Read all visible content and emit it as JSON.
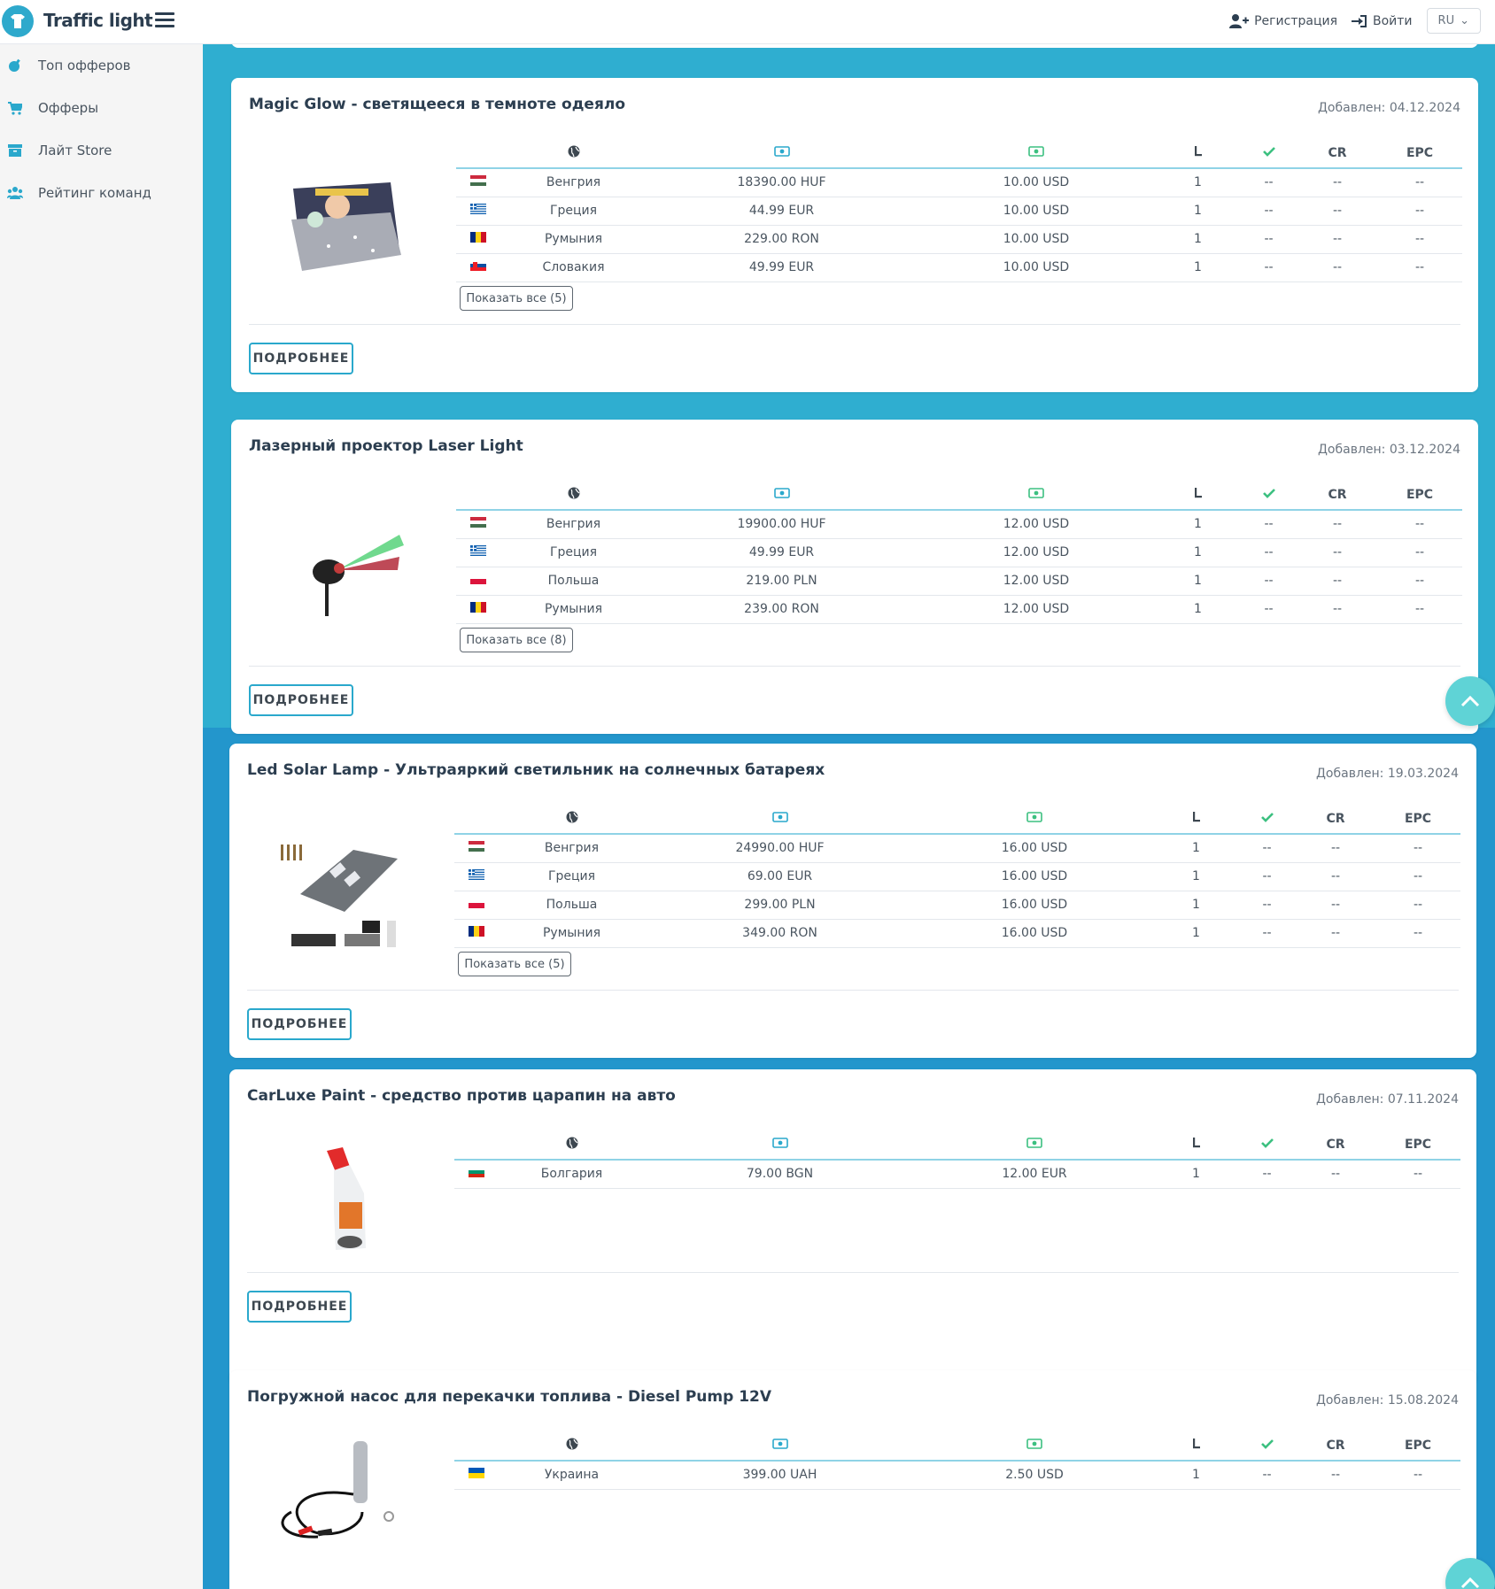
{
  "header": {
    "app_name": "Traffic light",
    "register_label": "Регистрация",
    "login_label": "Войти",
    "lang": "RU"
  },
  "sidebar": {
    "items": [
      {
        "label": "Топ офферов",
        "icon": "bomb-icon"
      },
      {
        "label": "Офферы",
        "icon": "cart-icon"
      },
      {
        "label": "Лайт Store",
        "icon": "archive-icon"
      },
      {
        "label": "Рейтинг команд",
        "icon": "users-icon"
      }
    ]
  },
  "table_headers": {
    "geo": "globe-icon",
    "price": "money-icon",
    "payout": "money-icon",
    "level": "level-icon",
    "approve": "check-icon",
    "cr": "CR",
    "epc": "EPC"
  },
  "colors": {
    "accent": "#2faed0",
    "band": "#2396cc",
    "check": "#3cc080"
  },
  "offers": [
    {
      "title": "Magic Glow - светящееся в темноте одеяло",
      "date": "Добавлен: 04.12.2024",
      "show_all": "Показать все (5)",
      "more": "ПОДРОБНЕЕ",
      "rows": [
        {
          "flag": "HU",
          "country": "Венгрия",
          "price": "18390.00 HUF",
          "payout": "10.00 USD",
          "lvl": "1",
          "appr": "--",
          "cr": "--",
          "epc": "--"
        },
        {
          "flag": "GR",
          "country": "Греция",
          "price": "44.99 EUR",
          "payout": "10.00 USD",
          "lvl": "1",
          "appr": "--",
          "cr": "--",
          "epc": "--"
        },
        {
          "flag": "RO",
          "country": "Румыния",
          "price": "229.00 RON",
          "payout": "10.00 USD",
          "lvl": "1",
          "appr": "--",
          "cr": "--",
          "epc": "--"
        },
        {
          "flag": "SK",
          "country": "Словакия",
          "price": "49.99 EUR",
          "payout": "10.00 USD",
          "lvl": "1",
          "appr": "--",
          "cr": "--",
          "epc": "--"
        }
      ]
    },
    {
      "title": "Лазерный проектор Laser Light",
      "date": "Добавлен: 03.12.2024",
      "show_all": "Показать все (8)",
      "more": "ПОДРОБНЕЕ",
      "rows": [
        {
          "flag": "HU",
          "country": "Венгрия",
          "price": "19900.00 HUF",
          "payout": "12.00 USD",
          "lvl": "1",
          "appr": "--",
          "cr": "--",
          "epc": "--"
        },
        {
          "flag": "GR",
          "country": "Греция",
          "price": "49.99 EUR",
          "payout": "12.00 USD",
          "lvl": "1",
          "appr": "--",
          "cr": "--",
          "epc": "--"
        },
        {
          "flag": "PL",
          "country": "Польша",
          "price": "219.00 PLN",
          "payout": "12.00 USD",
          "lvl": "1",
          "appr": "--",
          "cr": "--",
          "epc": "--"
        },
        {
          "flag": "RO",
          "country": "Румыния",
          "price": "239.00 RON",
          "payout": "12.00 USD",
          "lvl": "1",
          "appr": "--",
          "cr": "--",
          "epc": "--"
        }
      ]
    },
    {
      "title": "Led Solar Lamp - Ультраяркий светильник на солнечных батареях",
      "date": "Добавлен: 19.03.2024",
      "show_all": "Показать все (5)",
      "more": "ПОДРОБНЕЕ",
      "rows": [
        {
          "flag": "HU",
          "country": "Венгрия",
          "price": "24990.00 HUF",
          "payout": "16.00 USD",
          "lvl": "1",
          "appr": "--",
          "cr": "--",
          "epc": "--"
        },
        {
          "flag": "GR",
          "country": "Греция",
          "price": "69.00 EUR",
          "payout": "16.00 USD",
          "lvl": "1",
          "appr": "--",
          "cr": "--",
          "epc": "--"
        },
        {
          "flag": "PL",
          "country": "Польша",
          "price": "299.00 PLN",
          "payout": "16.00 USD",
          "lvl": "1",
          "appr": "--",
          "cr": "--",
          "epc": "--"
        },
        {
          "flag": "RO",
          "country": "Румыния",
          "price": "349.00 RON",
          "payout": "16.00 USD",
          "lvl": "1",
          "appr": "--",
          "cr": "--",
          "epc": "--"
        }
      ]
    },
    {
      "title": "CarLuxe Paint - средство против царапин на авто",
      "date": "Добавлен: 07.11.2024",
      "show_all": "",
      "more": "ПОДРОБНЕЕ",
      "rows": [
        {
          "flag": "BG",
          "country": "Болгария",
          "price": "79.00 BGN",
          "payout": "12.00 EUR",
          "lvl": "1",
          "appr": "--",
          "cr": "--",
          "epc": "--"
        }
      ]
    },
    {
      "title": "Погружной насос для перекачки топлива - Diesel Pump 12V",
      "date": "Добавлен: 15.08.2024",
      "show_all": "",
      "more": "",
      "rows": [
        {
          "flag": "UA",
          "country": "Украина",
          "price": "399.00 UAH",
          "payout": "2.50 USD",
          "lvl": "1",
          "appr": "--",
          "cr": "--",
          "epc": "--"
        }
      ]
    }
  ]
}
